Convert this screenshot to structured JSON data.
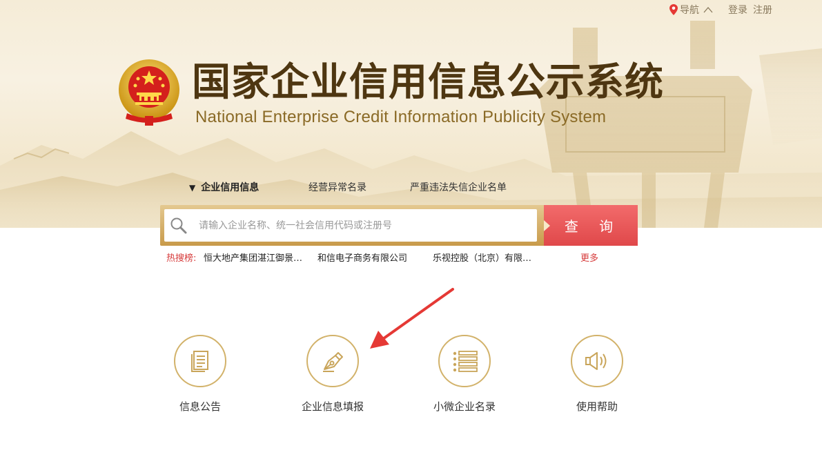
{
  "top_nav": {
    "nav_label": "导航",
    "login": "登录",
    "register": "注册"
  },
  "header": {
    "title_cn": "国家企业信用信息公示系统",
    "title_en": "National Enterprise Credit Information Publicity System"
  },
  "tabs": [
    {
      "label": "企业信用信息",
      "active": true
    },
    {
      "label": "经营异常名录",
      "active": false
    },
    {
      "label": "严重违法失信企业名单",
      "active": false
    }
  ],
  "search": {
    "placeholder": "请输入企业名称、统一社会信用代码或注册号",
    "value": "",
    "button_label": "查 询"
  },
  "hot_search": {
    "label": "热搜榜:",
    "items": [
      "恒大地产集团湛江御景…",
      "和信电子商务有限公司",
      "乐视控股（北京）有限…"
    ],
    "more": "更多"
  },
  "features": [
    {
      "label": "信息公告",
      "icon": "document-icon"
    },
    {
      "label": "企业信息填报",
      "icon": "pen-nib-icon"
    },
    {
      "label": "小微企业名录",
      "icon": "list-icon"
    },
    {
      "label": "使用帮助",
      "icon": "speaker-icon"
    }
  ],
  "colors": {
    "title": "#4e3611",
    "accent_gold": "#d2b26a",
    "search_button": "#e0484a",
    "hot_red": "#d63a3a",
    "annotation_arrow": "#e53935"
  }
}
